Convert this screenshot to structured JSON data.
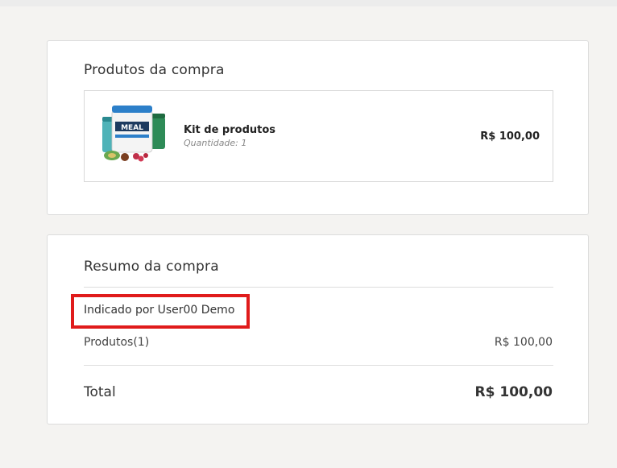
{
  "products_card": {
    "title": "Produtos da compra",
    "item": {
      "name": "Kit de produtos",
      "quantity": "Quantidade: 1",
      "price": "R$ 100,00"
    }
  },
  "summary_card": {
    "title": "Resumo da compra",
    "referral": "Indicado por User00 Demo",
    "products_label": "Produtos(1)",
    "products_value": "R$ 100,00",
    "total_label": "Total",
    "total_value": "R$ 100,00"
  },
  "colors": {
    "highlight": "#e01b1b",
    "background": "#f4f3f1"
  }
}
